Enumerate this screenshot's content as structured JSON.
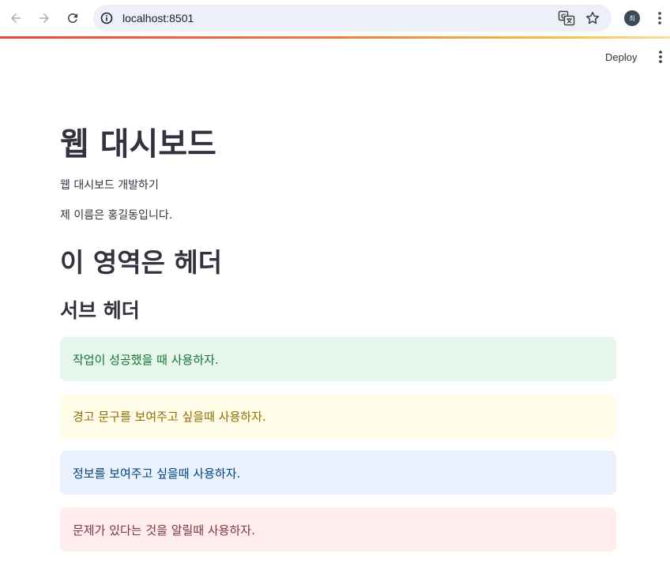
{
  "browser": {
    "url": "localhost:8501",
    "profile_initial": "최",
    "icons": {
      "back": "arrow-left-icon",
      "forward": "arrow-right-icon",
      "reload": "reload-icon",
      "site_info": "info-circle-icon",
      "translate": "translate-icon",
      "bookmark": "star-icon",
      "menu": "vertical-dots-icon"
    }
  },
  "app_header": {
    "deploy_label": "Deploy",
    "menu_icon": "vertical-dots-icon"
  },
  "main": {
    "title": "웹 대시보드",
    "text1": "웹 대시보드 개발하기",
    "text2": "제 이름은 홍길동입니다.",
    "header": "이 영역은 헤더",
    "subheader": "서브 헤더",
    "alerts": [
      {
        "type": "success",
        "message": "작업이 성공했을 때 사용하자."
      },
      {
        "type": "warning",
        "message": "경고 문구를 보여주고 싶을때 사용하자."
      },
      {
        "type": "info",
        "message": "정보를 보여주고 싶을때 사용하자."
      },
      {
        "type": "error",
        "message": "문제가 있다는 것을 알릴때 사용하자."
      }
    ]
  },
  "colors": {
    "success_bg": "#e7f7ec",
    "success_text": "#177233",
    "warning_bg": "#fffce7",
    "warning_text": "#926c05",
    "info_bg": "#e8f1fc",
    "info_text": "#004280",
    "error_bg": "#ffecec",
    "error_text": "#7d353b",
    "text": "#31333f"
  }
}
